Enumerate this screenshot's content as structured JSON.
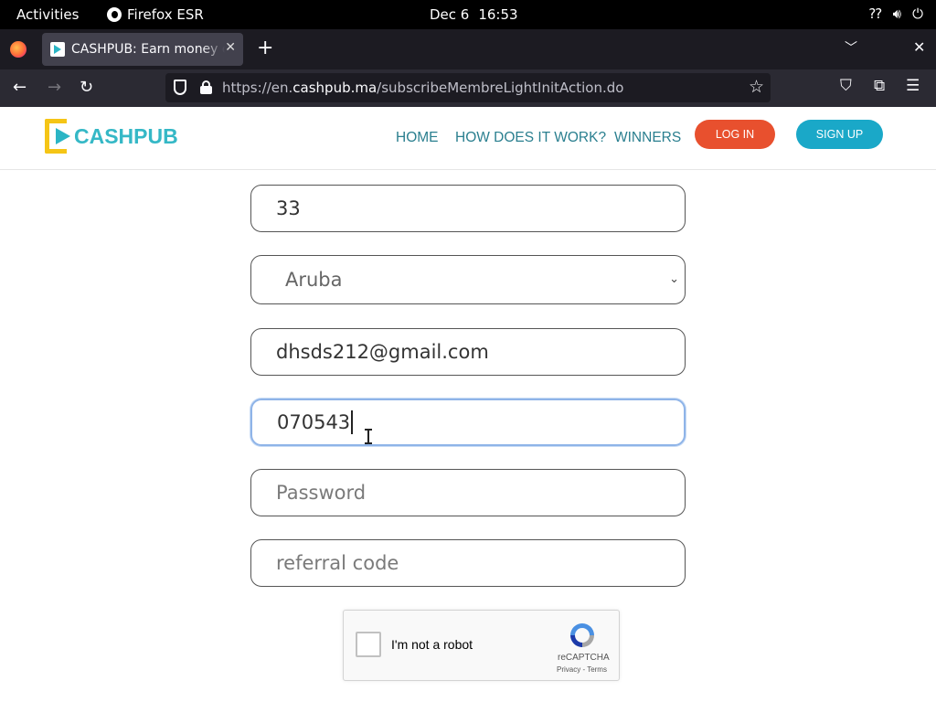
{
  "topbar": {
    "activities": "Activities",
    "app_name": "Firefox ESR",
    "date": "Dec 6",
    "time": "16:53"
  },
  "browser": {
    "tab_title": "CASHPUB: Earn money on",
    "url_prefix": "https://en.",
    "url_domain": "cashpub.ma",
    "url_path": "/subscribeMembreLightInitAction.do"
  },
  "site": {
    "logo_text": "CASHPUB",
    "nav": {
      "home": "HOME",
      "how": "HOW DOES IT WORK?",
      "winners": "WINNERS"
    },
    "login_label": "LOG IN",
    "signup_label": "SIGN UP"
  },
  "form": {
    "age_value": "33",
    "country_value": "Aruba",
    "email_value": "dhsds212@gmail.com",
    "phone_value": "070543",
    "password_placeholder": "Password",
    "referral_placeholder": "referral code"
  },
  "captcha": {
    "label": "I'm not a robot",
    "brand": "reCAPTCHA",
    "links": "Privacy - Terms"
  },
  "colors": {
    "login_button": "#e8502e",
    "signup_button": "#1aa8c8",
    "nav_text": "#2a7f8f",
    "logo_text": "#35b8c6"
  }
}
